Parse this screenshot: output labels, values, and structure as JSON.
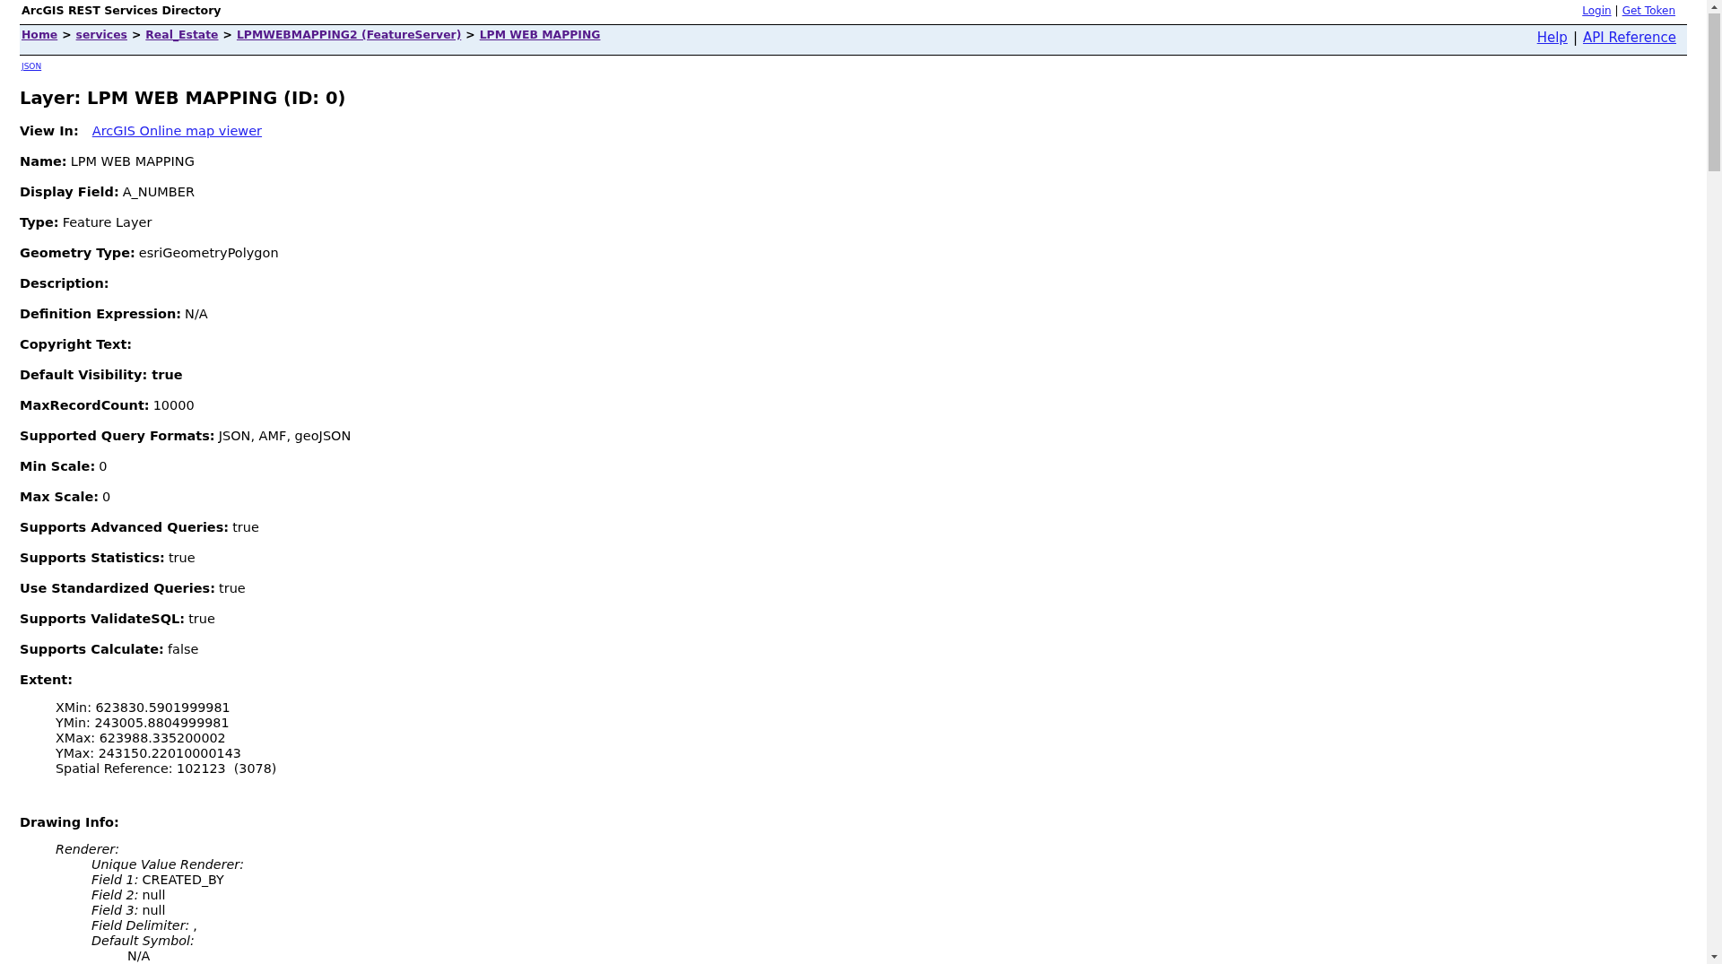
{
  "header": {
    "title": "ArcGIS REST Services Directory",
    "links": [
      "Login",
      "Get Token"
    ],
    "separator": "|"
  },
  "breadcrumb": {
    "items": [
      {
        "label": "Home",
        "visited": true
      },
      {
        "label": "services",
        "visited": true
      },
      {
        "label": "Real_Estate",
        "visited": true
      },
      {
        "label": "LPMWEBMAPPING2 (FeatureServer)",
        "visited": true
      },
      {
        "label": "LPM WEB MAPPING",
        "visited": true
      }
    ],
    "separator": ">",
    "links": [
      "Help",
      "API Reference"
    ],
    "links_separator": "|"
  },
  "formats": [
    "JSON"
  ],
  "heading": "Layer: LPM WEB MAPPING (ID: 0)",
  "view_in": {
    "label": "View In:",
    "link": "ArcGIS Online map viewer"
  },
  "properties": [
    {
      "label": "Name:",
      "value": "LPM WEB MAPPING"
    },
    {
      "label": "Display Field:",
      "value": "A_NUMBER"
    },
    {
      "label": "Type:",
      "value": "Feature Layer"
    },
    {
      "label": "Geometry Type:",
      "value": "esriGeometryPolygon"
    },
    {
      "label": "Description:"
    },
    {
      "label": "Definition Expression:",
      "value": "N/A"
    },
    {
      "label": "Copyright Text:"
    },
    {
      "label": "Default Visibility: true"
    },
    {
      "label": "MaxRecordCount:",
      "value": "10000"
    },
    {
      "label": "Supported Query Formats:",
      "value": "JSON, AMF, geoJSON"
    },
    {
      "label": "Min Scale:",
      "value": "0"
    },
    {
      "label": "Max Scale:",
      "value": "0"
    },
    {
      "label": "Supports Advanced Queries:",
      "value": "true"
    },
    {
      "label": "Supports Statistics:",
      "value": "true"
    },
    {
      "label": "Use Standardized Queries:",
      "value": "true"
    },
    {
      "label": "Supports ValidateSQL:",
      "value": "true"
    },
    {
      "label": "Supports Calculate:",
      "value": "false"
    }
  ],
  "extent": {
    "label": "Extent:",
    "lines": [
      "XMin: 623830.5901999981",
      "YMin: 243005.8804999981",
      "XMax: 623988.335200002",
      "YMax: 243150.22010000143",
      "Spatial Reference: 102123  (3078)"
    ]
  },
  "drawing_info": {
    "label": "Drawing Info:",
    "renderer": {
      "label": "Renderer:",
      "type": "Unique Value Renderer:",
      "fields": [
        {
          "label": "Field 1:",
          "value": "CREATED_BY"
        },
        {
          "label": "Field 2:",
          "value": "null"
        },
        {
          "label": "Field 3:",
          "value": "null"
        },
        {
          "label": "Field Delimiter:",
          "value": ","
        }
      ],
      "default_symbol": {
        "label": "Default Symbol:",
        "value": "N/A"
      }
    }
  }
}
